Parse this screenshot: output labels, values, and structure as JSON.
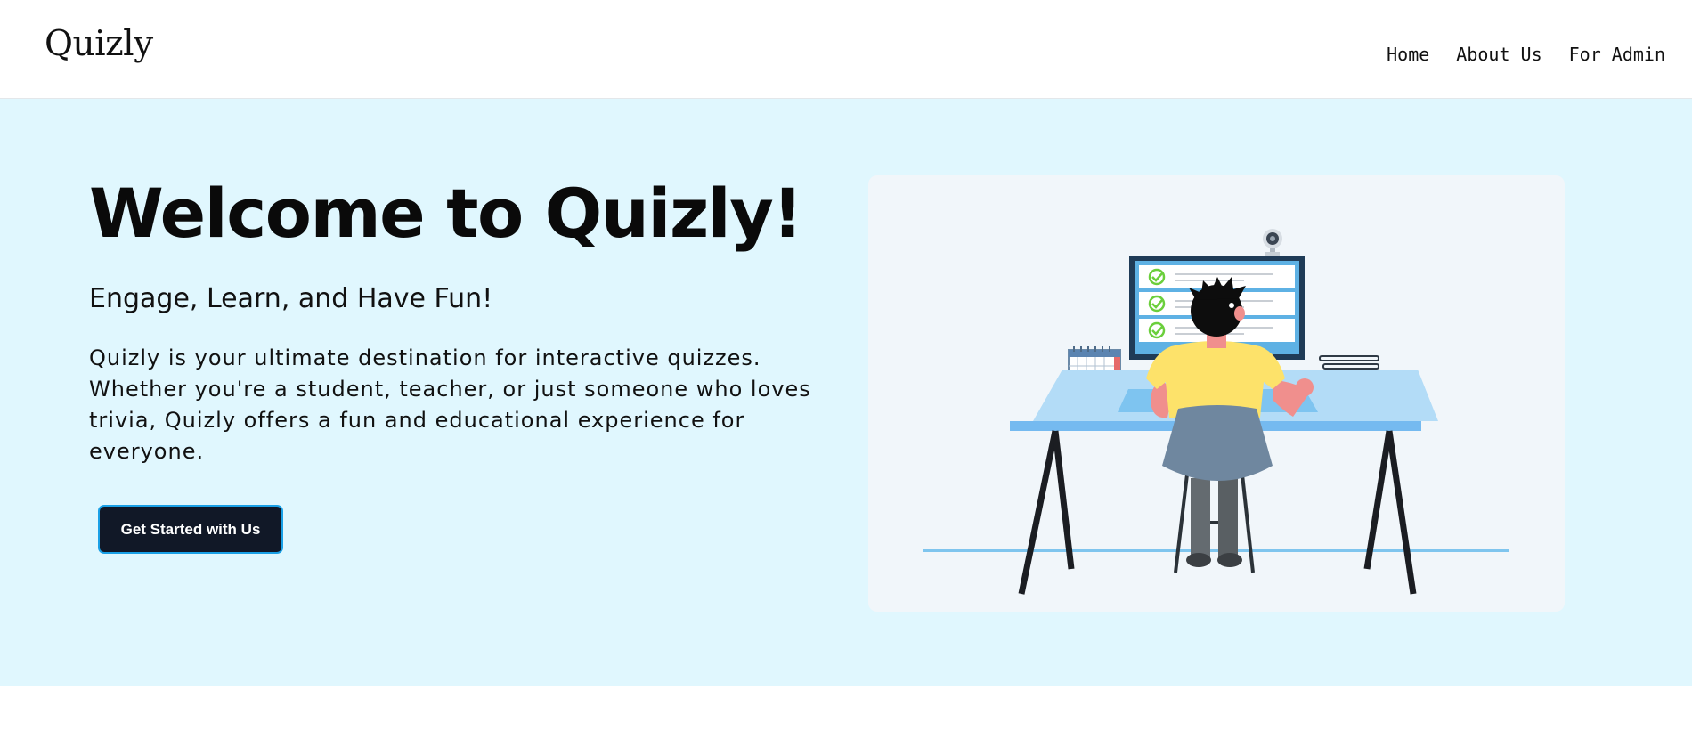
{
  "header": {
    "logo": "Quizly",
    "nav": [
      {
        "label": "Home"
      },
      {
        "label": "About Us"
      },
      {
        "label": "For Admin"
      }
    ]
  },
  "hero": {
    "title": "Welcome to Quizly!",
    "subtitle": "Engage, Learn, and Have Fun!",
    "description": "Quizly is your ultimate destination for interactive quizzes. Whether you're a student, teacher, or just someone who loves trivia, Quizly offers a fun and educational experience for everyone.",
    "cta_label": "Get Started with Us"
  },
  "colors": {
    "hero_background": "#e0f7fe",
    "cta_background": "#111827",
    "cta_border": "#1aa0e6",
    "illustration_card": "#f1f6fa",
    "desk_top": "#b3dcf7",
    "shirt": "#fde26a",
    "chair": "#6f879f",
    "check_green": "#6bcf3c"
  },
  "illustration": {
    "icon": "person-at-desk-quiz-illustration"
  }
}
